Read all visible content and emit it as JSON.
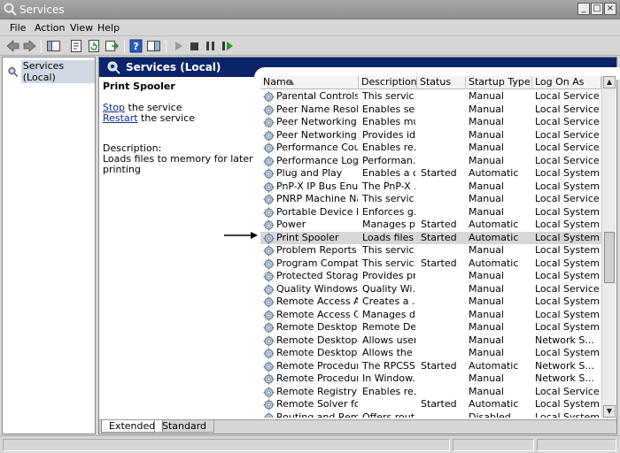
{
  "window": {
    "title": "Services"
  },
  "menu": [
    "File",
    "Action",
    "View",
    "Help"
  ],
  "tree": {
    "root_label": "Services (Local)"
  },
  "header": {
    "title": "Services (Local)"
  },
  "details": {
    "service_name": "Print Spooler",
    "stop_link": "Stop",
    "stop_suffix": " the service",
    "restart_link": "Restart",
    "restart_suffix": " the service",
    "description_label": "Description:",
    "description_text": "Loads files to memory for later printing"
  },
  "table": {
    "columns": [
      "Name",
      "Description",
      "Status",
      "Startup Type",
      "Log On As"
    ],
    "rows": [
      {
        "name": "Parental Controls",
        "description": "This servic...",
        "status": "",
        "startup": "Manual",
        "logon": "Local Service"
      },
      {
        "name": "Peer Name Resoluti...",
        "description": "Enables se...",
        "status": "",
        "startup": "Manual",
        "logon": "Local Service"
      },
      {
        "name": "Peer Networking Gr...",
        "description": "Enables mu...",
        "status": "",
        "startup": "Manual",
        "logon": "Local Service"
      },
      {
        "name": "Peer Networking Id...",
        "description": "Provides id...",
        "status": "",
        "startup": "Manual",
        "logon": "Local Service"
      },
      {
        "name": "Performance Count...",
        "description": "Enables re...",
        "status": "",
        "startup": "Manual",
        "logon": "Local Service"
      },
      {
        "name": "Performance Logs ...",
        "description": "Performan...",
        "status": "",
        "startup": "Manual",
        "logon": "Local Service"
      },
      {
        "name": "Plug and Play",
        "description": "Enables a c...",
        "status": "Started",
        "startup": "Automatic",
        "logon": "Local System"
      },
      {
        "name": "PnP-X IP Bus Enum...",
        "description": "The PnP-X ...",
        "status": "",
        "startup": "Manual",
        "logon": "Local System"
      },
      {
        "name": "PNRP Machine Nam...",
        "description": "This servic...",
        "status": "",
        "startup": "Manual",
        "logon": "Local Service"
      },
      {
        "name": "Portable Device En...",
        "description": "Enforces g...",
        "status": "",
        "startup": "Manual",
        "logon": "Local System"
      },
      {
        "name": "Power",
        "description": "Manages p...",
        "status": "Started",
        "startup": "Automatic",
        "logon": "Local System"
      },
      {
        "name": "Print Spooler",
        "description": "Loads files ...",
        "status": "Started",
        "startup": "Automatic",
        "logon": "Local System",
        "selected": true
      },
      {
        "name": "Problem Reports an...",
        "description": "This servic...",
        "status": "",
        "startup": "Manual",
        "logon": "Local System"
      },
      {
        "name": "Program Compatibili...",
        "description": "This servic...",
        "status": "Started",
        "startup": "Automatic",
        "logon": "Local System"
      },
      {
        "name": "Protected Storage",
        "description": "Provides pr...",
        "status": "",
        "startup": "Manual",
        "logon": "Local System"
      },
      {
        "name": "Quality Windows A...",
        "description": "Quality Wi...",
        "status": "",
        "startup": "Manual",
        "logon": "Local Service"
      },
      {
        "name": "Remote Access Aut...",
        "description": "Creates a ...",
        "status": "",
        "startup": "Manual",
        "logon": "Local System"
      },
      {
        "name": "Remote Access Co...",
        "description": "Manages di...",
        "status": "",
        "startup": "Manual",
        "logon": "Local System"
      },
      {
        "name": "Remote Desktop C...",
        "description": "Remote De...",
        "status": "",
        "startup": "Manual",
        "logon": "Local System"
      },
      {
        "name": "Remote Desktop Se...",
        "description": "Allows user...",
        "status": "",
        "startup": "Manual",
        "logon": "Network S..."
      },
      {
        "name": "Remote Desktop Se...",
        "description": "Allows the ...",
        "status": "",
        "startup": "Manual",
        "logon": "Local System"
      },
      {
        "name": "Remote Procedure ...",
        "description": "The RPCSS...",
        "status": "Started",
        "startup": "Automatic",
        "logon": "Network S..."
      },
      {
        "name": "Remote Procedure ...",
        "description": "In Window...",
        "status": "",
        "startup": "Manual",
        "logon": "Network S..."
      },
      {
        "name": "Remote Registry",
        "description": "Enables re...",
        "status": "",
        "startup": "Manual",
        "logon": "Local Service"
      },
      {
        "name": "Remote Solver for ...",
        "description": "",
        "status": "Started",
        "startup": "Automatic",
        "logon": "Local System"
      },
      {
        "name": "Routing and Remot...",
        "description": "Offers rout...",
        "status": "",
        "startup": "Disabled",
        "logon": "Local System"
      }
    ]
  },
  "tabs": [
    "Extended",
    "Standard"
  ],
  "active_tab": "Extended",
  "colors": {
    "header_bg": "#0a246a",
    "selected_row": "#d7d7d7"
  }
}
